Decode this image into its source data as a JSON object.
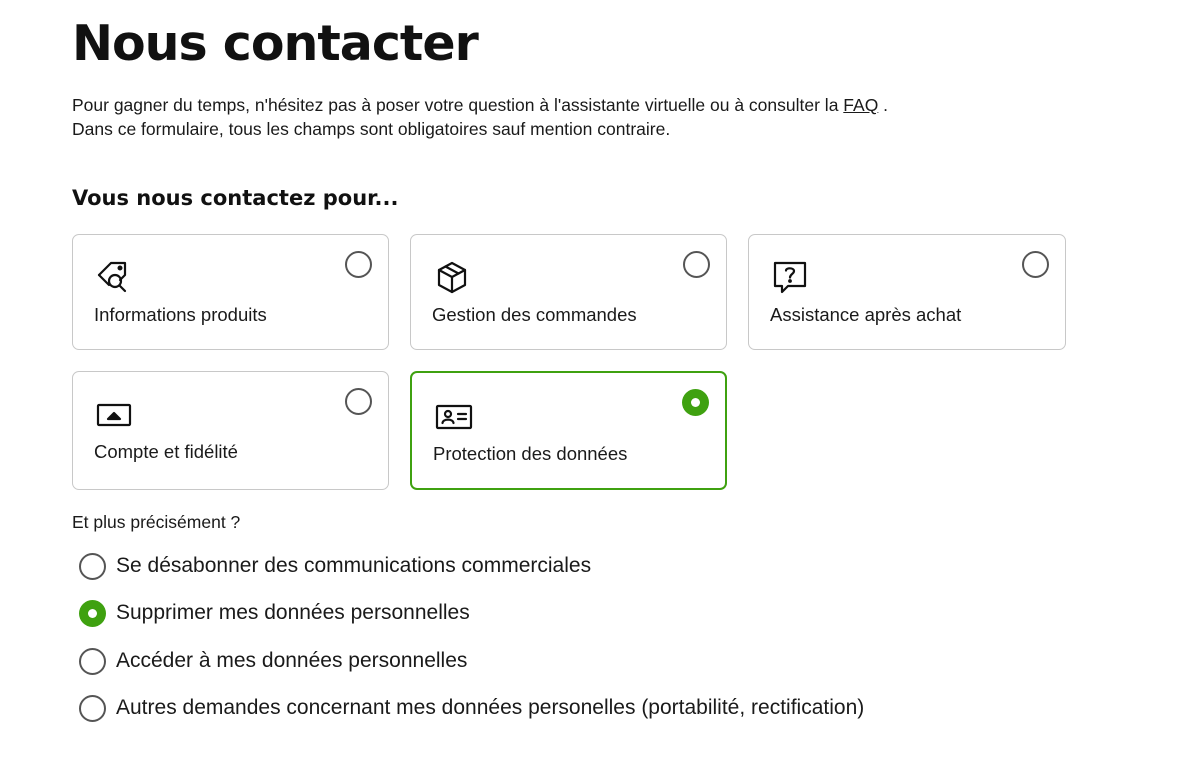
{
  "page": {
    "title": "Nous contacter",
    "intro": {
      "line1_before": "Pour gagner du temps, n'hésitez pas à poser votre question à l'assistante virtuelle ou à consulter la ",
      "faq_link": "FAQ",
      "line1_after": " .",
      "line2": "Dans ce formulaire, tous les champs sont obligatoires sauf mention contraire."
    }
  },
  "topics": {
    "heading": "Vous nous contactez pour...",
    "items": [
      {
        "label": "Informations produits",
        "icon": "tag-search-icon",
        "selected": false
      },
      {
        "label": "Gestion des commandes",
        "icon": "package-box-icon",
        "selected": false
      },
      {
        "label": "Assistance après achat",
        "icon": "question-bubble-icon",
        "selected": false
      },
      {
        "label": "Compte et fidélité",
        "icon": "account-card-icon",
        "selected": false
      },
      {
        "label": "Protection des données",
        "icon": "id-card-icon",
        "selected": true
      }
    ]
  },
  "details": {
    "heading": "Et plus précisément ?",
    "options": [
      {
        "label": "Se désabonner des communications commerciales",
        "selected": false
      },
      {
        "label": "Supprimer mes données personnelles",
        "selected": true
      },
      {
        "label": "Accéder à mes données personnelles",
        "selected": false
      },
      {
        "label": "Autres demandes concernant mes données personelles (portabilité, rectification)",
        "selected": false
      }
    ]
  },
  "colors": {
    "accent": "#3fa110",
    "border": "#c8c8c8",
    "text": "#111111"
  }
}
